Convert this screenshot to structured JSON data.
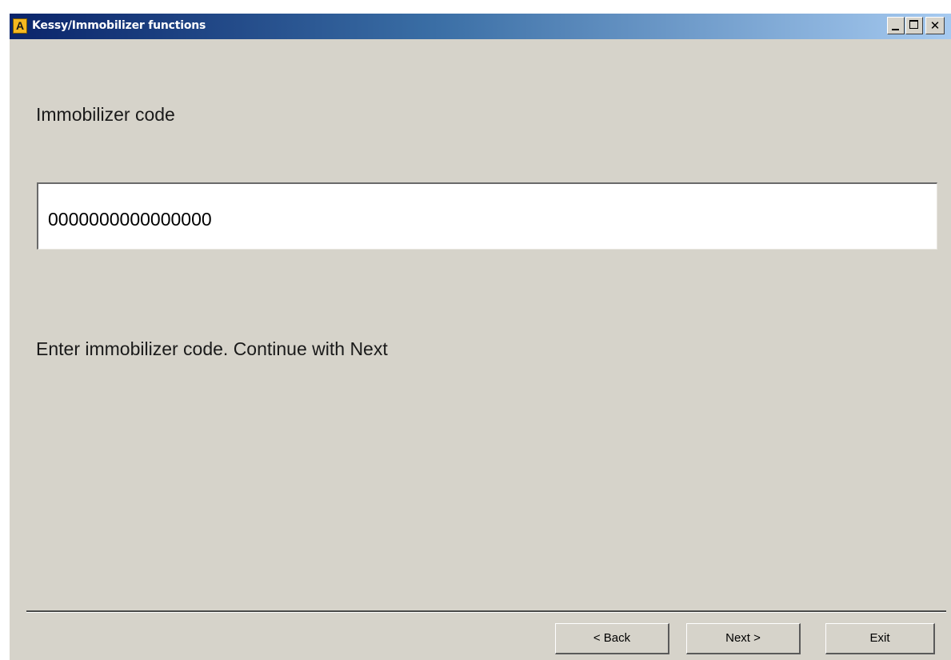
{
  "window": {
    "title": "Kessy/Immobilizer functions",
    "icon": "app-icon-letter-a"
  },
  "main": {
    "heading": "Immobilizer code",
    "code_value": "0000000000000000",
    "instruction": "Enter immobilizer code. Continue with Next"
  },
  "footer": {
    "back_label": "< Back",
    "next_label": "Next >",
    "exit_label": "Exit"
  },
  "colors": {
    "titlebar_start": "#0a246a",
    "titlebar_end": "#a6caf0",
    "window_bg": "#d6d3ca",
    "field_bg": "#ffffff"
  }
}
